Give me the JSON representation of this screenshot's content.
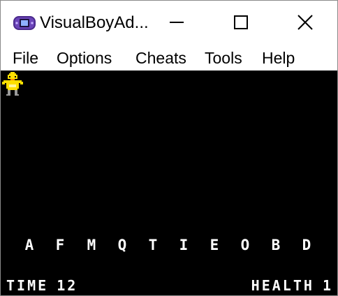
{
  "window": {
    "title": "VisualBoyAd..."
  },
  "menu": {
    "file": "File",
    "options": "Options",
    "cheats": "Cheats",
    "tools": "Tools",
    "help": "Help"
  },
  "game": {
    "letters": [
      "A",
      "F",
      "M",
      "Q",
      "T",
      "I",
      "E",
      "O",
      "B",
      "D"
    ],
    "time_label": "TIME",
    "time_value": "12",
    "health_label": "HEALTH",
    "health_value": "1"
  },
  "colors": {
    "screen_bg": "#000000",
    "text": "#ffffff",
    "sprite": "#ffe000"
  },
  "icons": {
    "app": "gameboy-advance-icon",
    "player": "bird-sprite-icon"
  }
}
